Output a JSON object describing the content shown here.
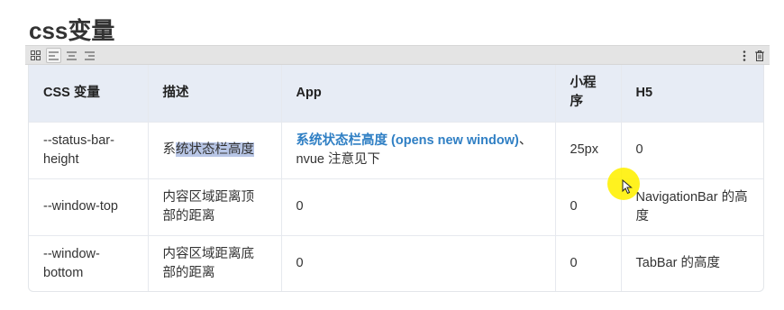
{
  "title": "css变量",
  "toolbar": {
    "left_buttons": [
      "grid-icon",
      "align-left-icon",
      "align-center-icon",
      "align-right-icon"
    ],
    "right_buttons": [
      "more-vertical-icon",
      "trash-icon"
    ]
  },
  "table": {
    "headers": [
      "CSS 变量",
      "描述",
      "App",
      "小程序",
      "H5"
    ],
    "rows": [
      {
        "var": "--status-bar-height",
        "desc_prefix": "系",
        "desc_highlight": "统状态栏高度",
        "app_link": "系统状态栏高度 (opens new window)",
        "app_suffix": "、nvue 注意见下",
        "mp": "25px",
        "h5": "0"
      },
      {
        "var": "--window-top",
        "desc": "内容区域距离顶部的距离",
        "app": "0",
        "mp": "0",
        "h5": "NavigationBar 的高度"
      },
      {
        "var": "--window-bottom",
        "desc": "内容区域距离底部的距离",
        "app": "0",
        "mp": "0",
        "h5": "TabBar 的高度"
      }
    ]
  },
  "colors": {
    "header_bg": "#e7ecf5",
    "link": "#2f7fc4",
    "selection": "#b8c6e6",
    "cursor_highlight": "#fff000"
  }
}
